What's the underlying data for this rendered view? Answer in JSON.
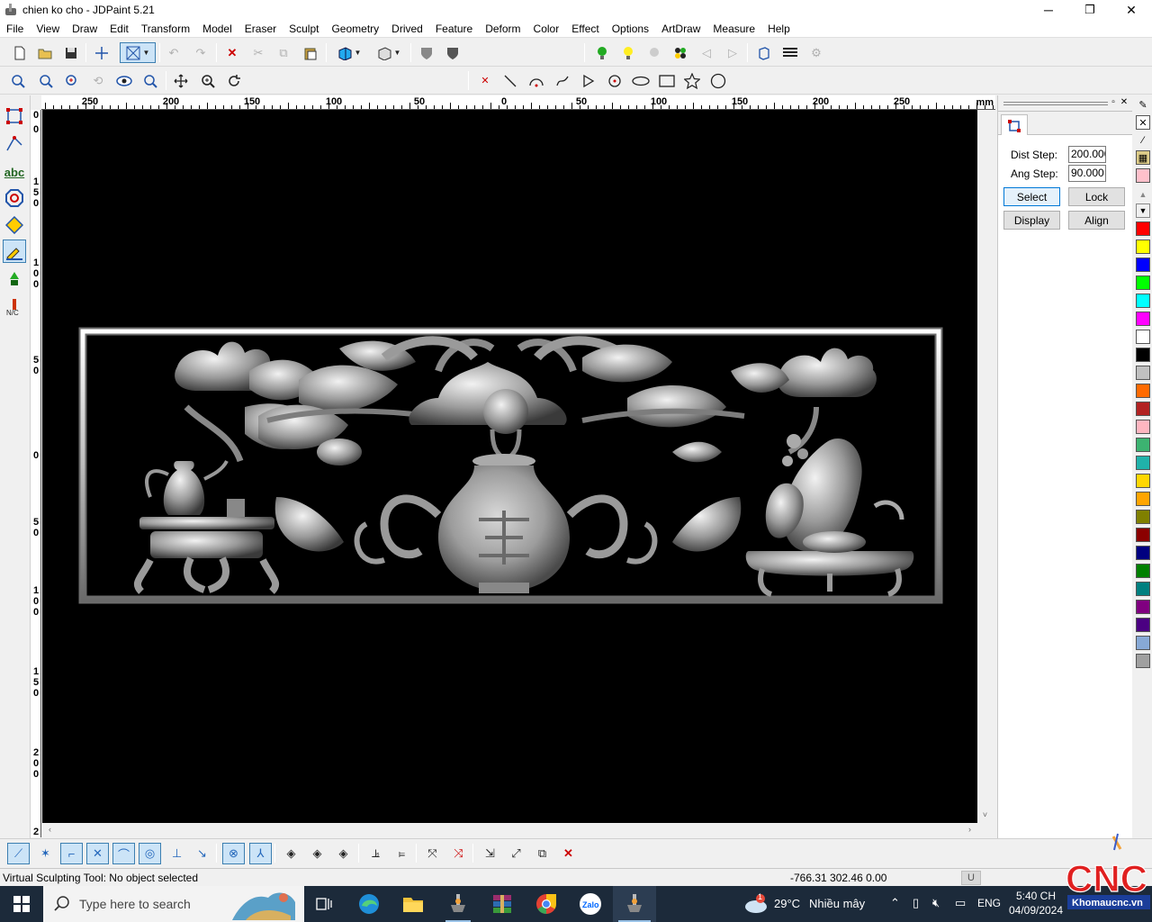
{
  "window": {
    "title": "chien ko cho - JDPaint 5.21",
    "minimize": "─",
    "maximize": "❐",
    "close": "✕"
  },
  "menu": [
    "File",
    "View",
    "Draw",
    "Edit",
    "Transform",
    "Model",
    "Eraser",
    "Sculpt",
    "Geometry",
    "Drived",
    "Feature",
    "Deform",
    "Color",
    "Effect",
    "Options",
    "ArtDraw",
    "Measure",
    "Help"
  ],
  "ruler": {
    "unit": "mm",
    "top_labels": [
      "250",
      "200",
      "150",
      "100",
      "50",
      "0",
      "50",
      "100",
      "150",
      "200",
      "250"
    ],
    "left_labels": [
      "0",
      "0",
      "1 5 0",
      "1 0 0",
      "5 0",
      "0",
      "5 0",
      "1 0 0",
      "1 5 0",
      "2 0 0",
      "2"
    ]
  },
  "panel": {
    "dist_step_label": "Dist Step:",
    "dist_step_value": "200.000",
    "ang_step_label": "Ang Step:",
    "ang_step_value": "90.000",
    "select_label": "Select",
    "lock_label": "Lock",
    "display_label": "Display",
    "align_label": "Align"
  },
  "palette_colors": [
    "#ff0000",
    "#ffff00",
    "#0000ff",
    "#00ff00",
    "#00ffff",
    "#ff00ff",
    "#ffffff",
    "#000000",
    "#c0c0c0",
    "#ff6a00",
    "#b22222",
    "#ffb6c1",
    "#3cb371",
    "#20b2aa",
    "#ffd700",
    "#ffa500",
    "#808000",
    "#8b0000",
    "#000080",
    "#008000",
    "#008080",
    "#800080",
    "#4b0082",
    "#87a9d6",
    "#a0a0a0"
  ],
  "status": {
    "message": "Virtual Sculpting Tool: No object selected",
    "coords": "-766.31 302.46 0.00",
    "mode": "U"
  },
  "taskbar": {
    "search_placeholder": "Type here to search",
    "weather_temp": "29°C",
    "weather_desc": "Nhiều mây",
    "weather_badge": "1",
    "language": "ENG",
    "time": "5:40 CH",
    "date": "04/09/2024"
  },
  "watermark": {
    "logo_text": "CNC",
    "site": "Khomaucnc.vn"
  }
}
